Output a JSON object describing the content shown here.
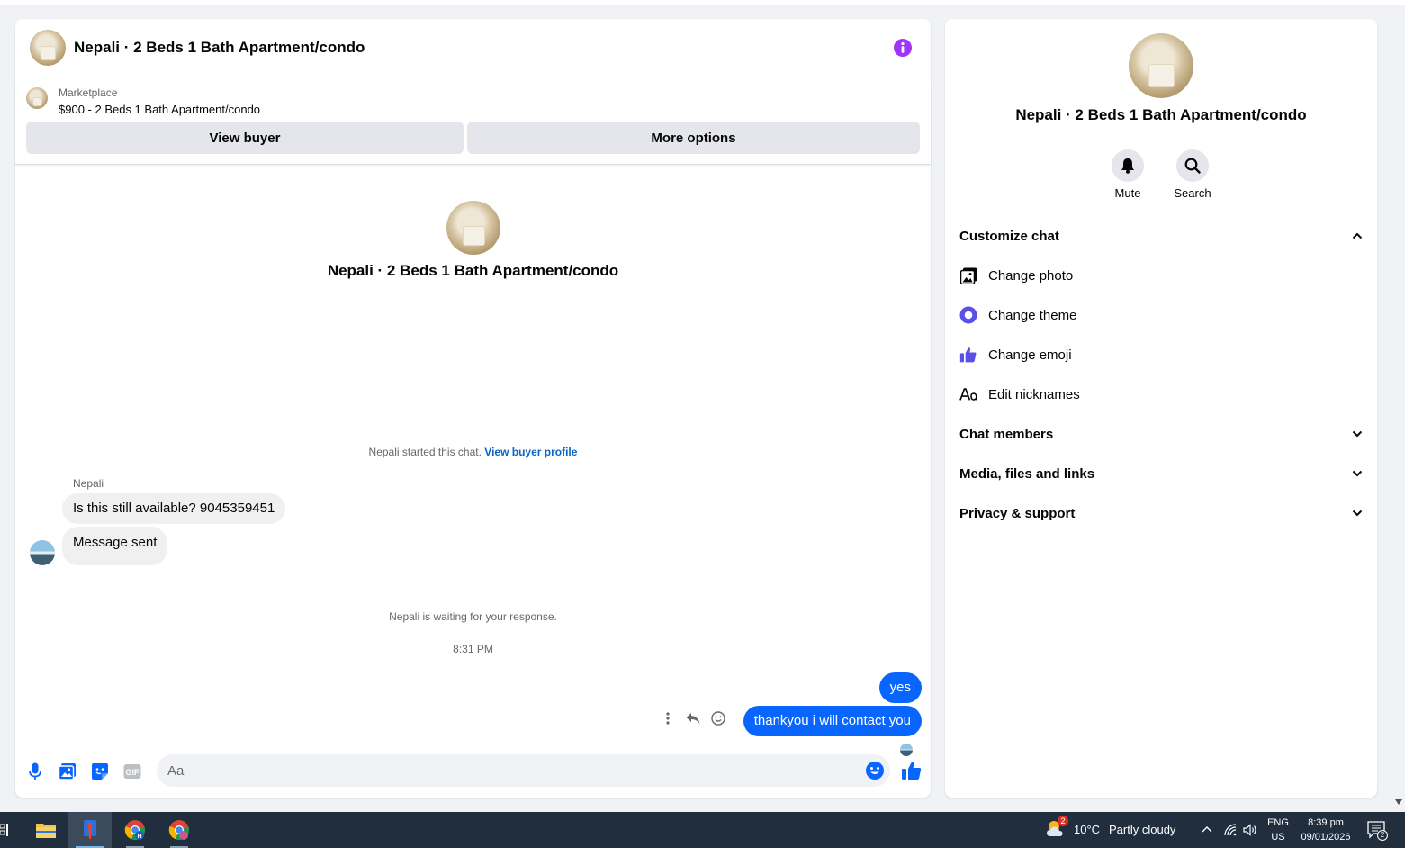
{
  "chat": {
    "title": "Nepali · 2 Beds 1 Bath Apartment/condo",
    "listing": {
      "source": "Marketplace",
      "name": "$900 - 2 Beds 1 Bath Apartment/condo",
      "view_buyer_label": "View buyer",
      "more_options_label": "More options"
    },
    "intro_title": "Nepali · 2 Beds 1 Bath Apartment/condo",
    "started_text": "Nepali started this chat.",
    "view_profile_link": "View buyer profile",
    "sender_name": "Nepali",
    "incoming": [
      "Is this still available? 9045359451",
      "Message sent"
    ],
    "waiting_text": "Nepali is waiting for your response.",
    "timestamp": "8:31 PM",
    "outgoing": [
      "yes",
      "thankyou i will contact you"
    ],
    "composer_placeholder": "Aa"
  },
  "info": {
    "title": "Nepali · 2 Beds 1 Bath Apartment/condo",
    "mute_label": "Mute",
    "search_label": "Search",
    "customize_label": "Customize chat",
    "customize_items": [
      "Change photo",
      "Change theme",
      "Change emoji",
      "Edit nicknames"
    ],
    "sections": [
      "Chat members",
      "Media, files and links",
      "Privacy & support"
    ]
  },
  "taskbar": {
    "weather_temp": "10°C",
    "weather_desc": "Partly cloudy",
    "weather_badge": "2",
    "lang_top": "ENG",
    "lang_bottom": "US",
    "time": "8:39 pm",
    "date": "09/01/2026",
    "notif_count": "2"
  },
  "colors": {
    "accent": "#0866ff",
    "theme_icon": "#5b4fe9",
    "info_purple": "#a033ff",
    "taskbar": "#202e3d"
  }
}
